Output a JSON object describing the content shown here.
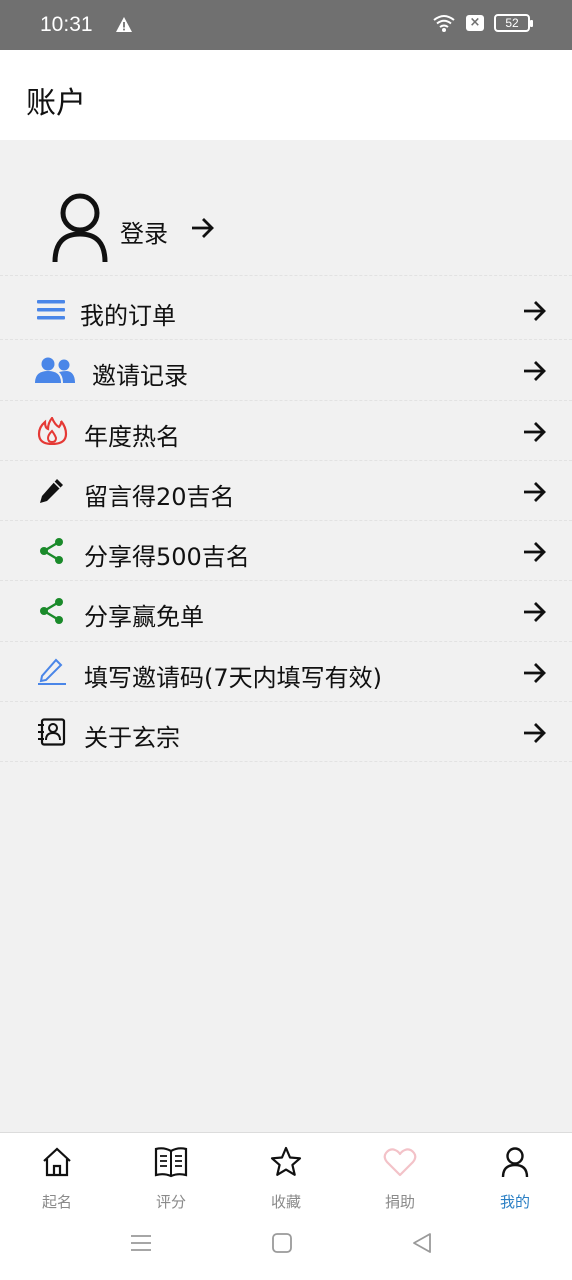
{
  "status_bar": {
    "time": "10:31",
    "battery": "52"
  },
  "header": {
    "title": "账户"
  },
  "login": {
    "label": "登录"
  },
  "menu": [
    {
      "label": "我的订单",
      "icon": "list-icon"
    },
    {
      "label": "邀请记录",
      "icon": "users-icon"
    },
    {
      "label": "年度热名",
      "icon": "fire-icon"
    },
    {
      "label": "留言得20吉名",
      "icon": "pencil-icon"
    },
    {
      "label": "分享得500吉名",
      "icon": "share-icon"
    },
    {
      "label": "分享赢免单",
      "icon": "share-icon"
    },
    {
      "label": "填写邀请码(7天内填写有效)",
      "icon": "edit-icon"
    },
    {
      "label": "关于玄宗",
      "icon": "contact-card-icon"
    }
  ],
  "bottom_nav": [
    {
      "label": "起名",
      "icon": "home-icon"
    },
    {
      "label": "评分",
      "icon": "book-icon"
    },
    {
      "label": "收藏",
      "icon": "star-icon"
    },
    {
      "label": "捐助",
      "icon": "heart-icon"
    },
    {
      "label": "我的",
      "icon": "user-icon",
      "active": true
    }
  ],
  "colors": {
    "accent": "#2a7fc4",
    "blue_icon": "#4a86e8",
    "fire": "#e53935",
    "share": "#1a8a2a",
    "heart": "#f3c2c8"
  }
}
